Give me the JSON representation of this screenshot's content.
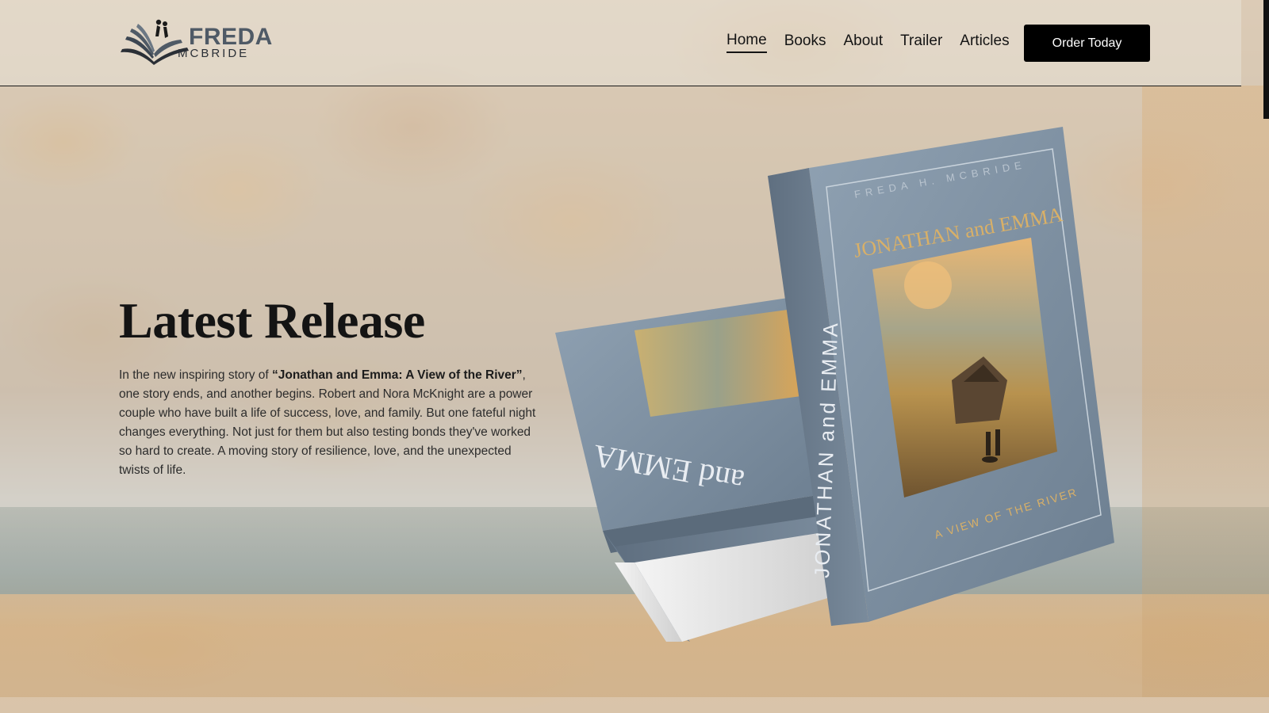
{
  "brand": {
    "name": "FREDA",
    "sub": "MCBRIDE"
  },
  "nav": {
    "items": [
      {
        "label": "Home",
        "active": true
      },
      {
        "label": "Books",
        "active": false
      },
      {
        "label": "About",
        "active": false
      },
      {
        "label": "Trailer",
        "active": false
      },
      {
        "label": "Articles",
        "active": false
      }
    ],
    "cta_label": "Order Today"
  },
  "hero": {
    "title": "Latest Release",
    "desc_before": "In the new inspiring story of ",
    "desc_book": "“Jonathan and Emma: A View of the River”",
    "desc_after": ", one story ends, and another begins. Robert and Nora McKnight are a power couple who have built a life of success, love, and family. But one fateful night changes everything. Not just for them but also testing bonds they've worked so hard to create. A moving story of resilience, love, and the unexpected twists of life."
  },
  "book": {
    "author": "FREDA H. MCBRIDE",
    "title": "JONATHAN and EMMA",
    "subtitle": "A VIEW OF THE RIVER",
    "spine": "JONATHAN and EMMA",
    "back_spine": "and EMMA",
    "cover_color": "#7d8fa0",
    "accent_color": "#d9b067"
  },
  "colors": {
    "button_bg": "#000000",
    "text": "#141414"
  }
}
